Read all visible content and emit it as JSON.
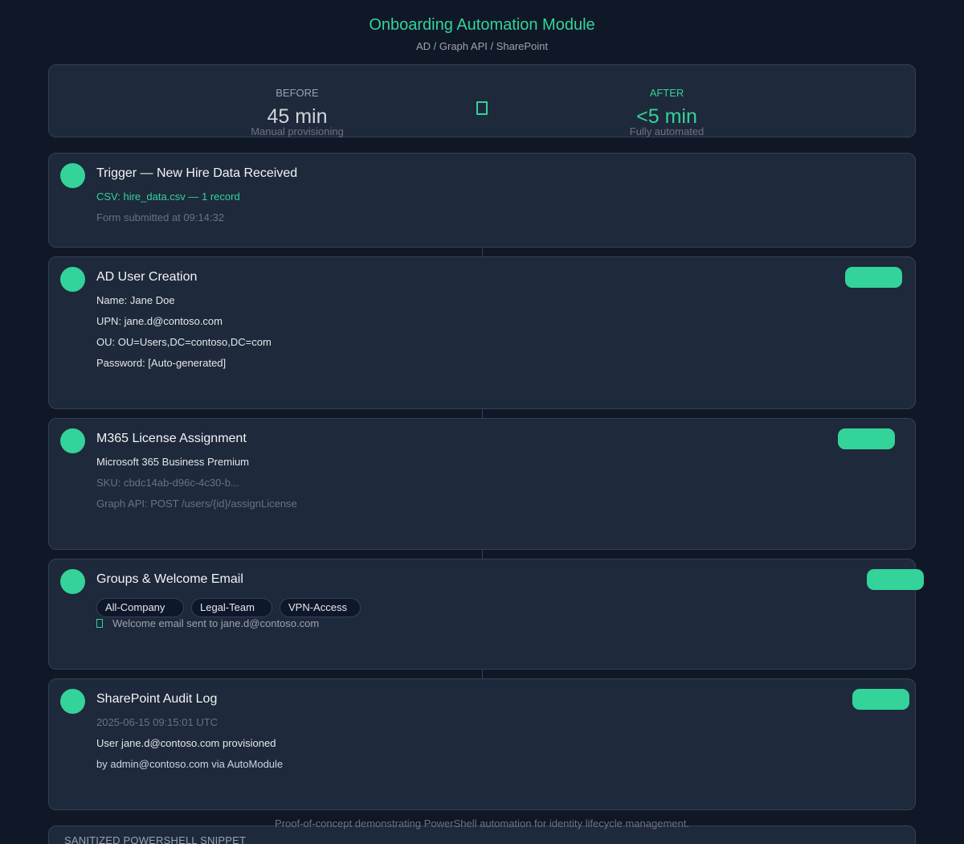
{
  "header": {
    "title": "Onboarding Automation Module",
    "subtitle": "AD / Graph API / SharePoint"
  },
  "comparison": {
    "before": {
      "label": "BEFORE",
      "value": "45 min",
      "note": "Manual provisioning"
    },
    "after": {
      "label": "AFTER",
      "value": "<5 min",
      "note": "Fully automated"
    },
    "arrow_icon": "arrow-right-icon"
  },
  "steps": {
    "trigger": {
      "title": "Trigger — New Hire Data Received",
      "line1": "CSV: hire_data.csv — 1 record",
      "line2": "Form submitted at 09:14:32"
    },
    "ad_user": {
      "title": "AD User Creation",
      "name": "Name: Jane Doe",
      "upn": "UPN: jane.d@contoso.com",
      "ou": "OU: OU=Users,DC=contoso,DC=com",
      "password": "Password: [Auto-generated]"
    },
    "license": {
      "title": "M365 License Assignment",
      "product": "Microsoft 365 Business Premium",
      "sku": "SKU: cbdc14ab-d96c-4c30-b...",
      "api": "Graph API: POST /users/{id}/assignLicense"
    },
    "groups": {
      "title": "Groups & Welcome Email",
      "chips": [
        "All-Company",
        "Legal-Team",
        "VPN-Access"
      ],
      "email_status": "Welcome email sent to jane.d@contoso.com"
    },
    "audit": {
      "title": "SharePoint Audit Log",
      "timestamp": "2025-06-15 09:15:01 UTC",
      "entry": "User jane.d@contoso.com provisioned",
      "actor": "by admin@contoso.com via AutoModule"
    }
  },
  "colors": {
    "accent": "#34d399",
    "background": "#101827",
    "card": "#1e293b"
  },
  "footer": {
    "text": "Proof-of-concept demonstrating PowerShell automation for identity lifecycle management.",
    "snippet_label": "SANITIZED POWERSHELL SNIPPET"
  }
}
